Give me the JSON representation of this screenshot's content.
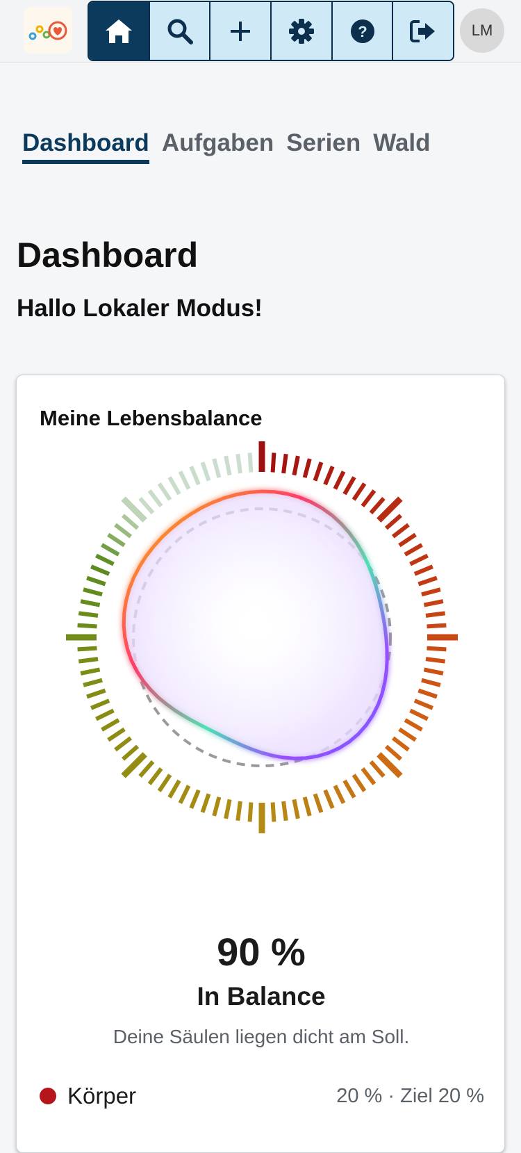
{
  "header": {
    "avatar_initials": "LM",
    "tools": [
      {
        "name": "home-icon",
        "active": true
      },
      {
        "name": "search-icon"
      },
      {
        "name": "plus-icon"
      },
      {
        "name": "gear-icon"
      },
      {
        "name": "help-icon"
      },
      {
        "name": "logout-icon"
      }
    ],
    "accent_color": "#0b3a5c",
    "tool_bg_color": "#cfe9f7"
  },
  "tabs": [
    {
      "label": "Dashboard",
      "active": true
    },
    {
      "label": "Aufgaben"
    },
    {
      "label": "Serien"
    },
    {
      "label": "Wald"
    }
  ],
  "page": {
    "title": "Dashboard",
    "greeting": "Hallo Lokaler Modus!"
  },
  "balance_card": {
    "title": "Meine Lebensbalance",
    "percent": "90 %",
    "state": "In Balance",
    "description": "Deine Säulen liegen dicht am Soll.",
    "legend": [
      {
        "name": "Körper",
        "value": "20 % · Ziel 20 %",
        "color": "#b4161b"
      }
    ]
  }
}
